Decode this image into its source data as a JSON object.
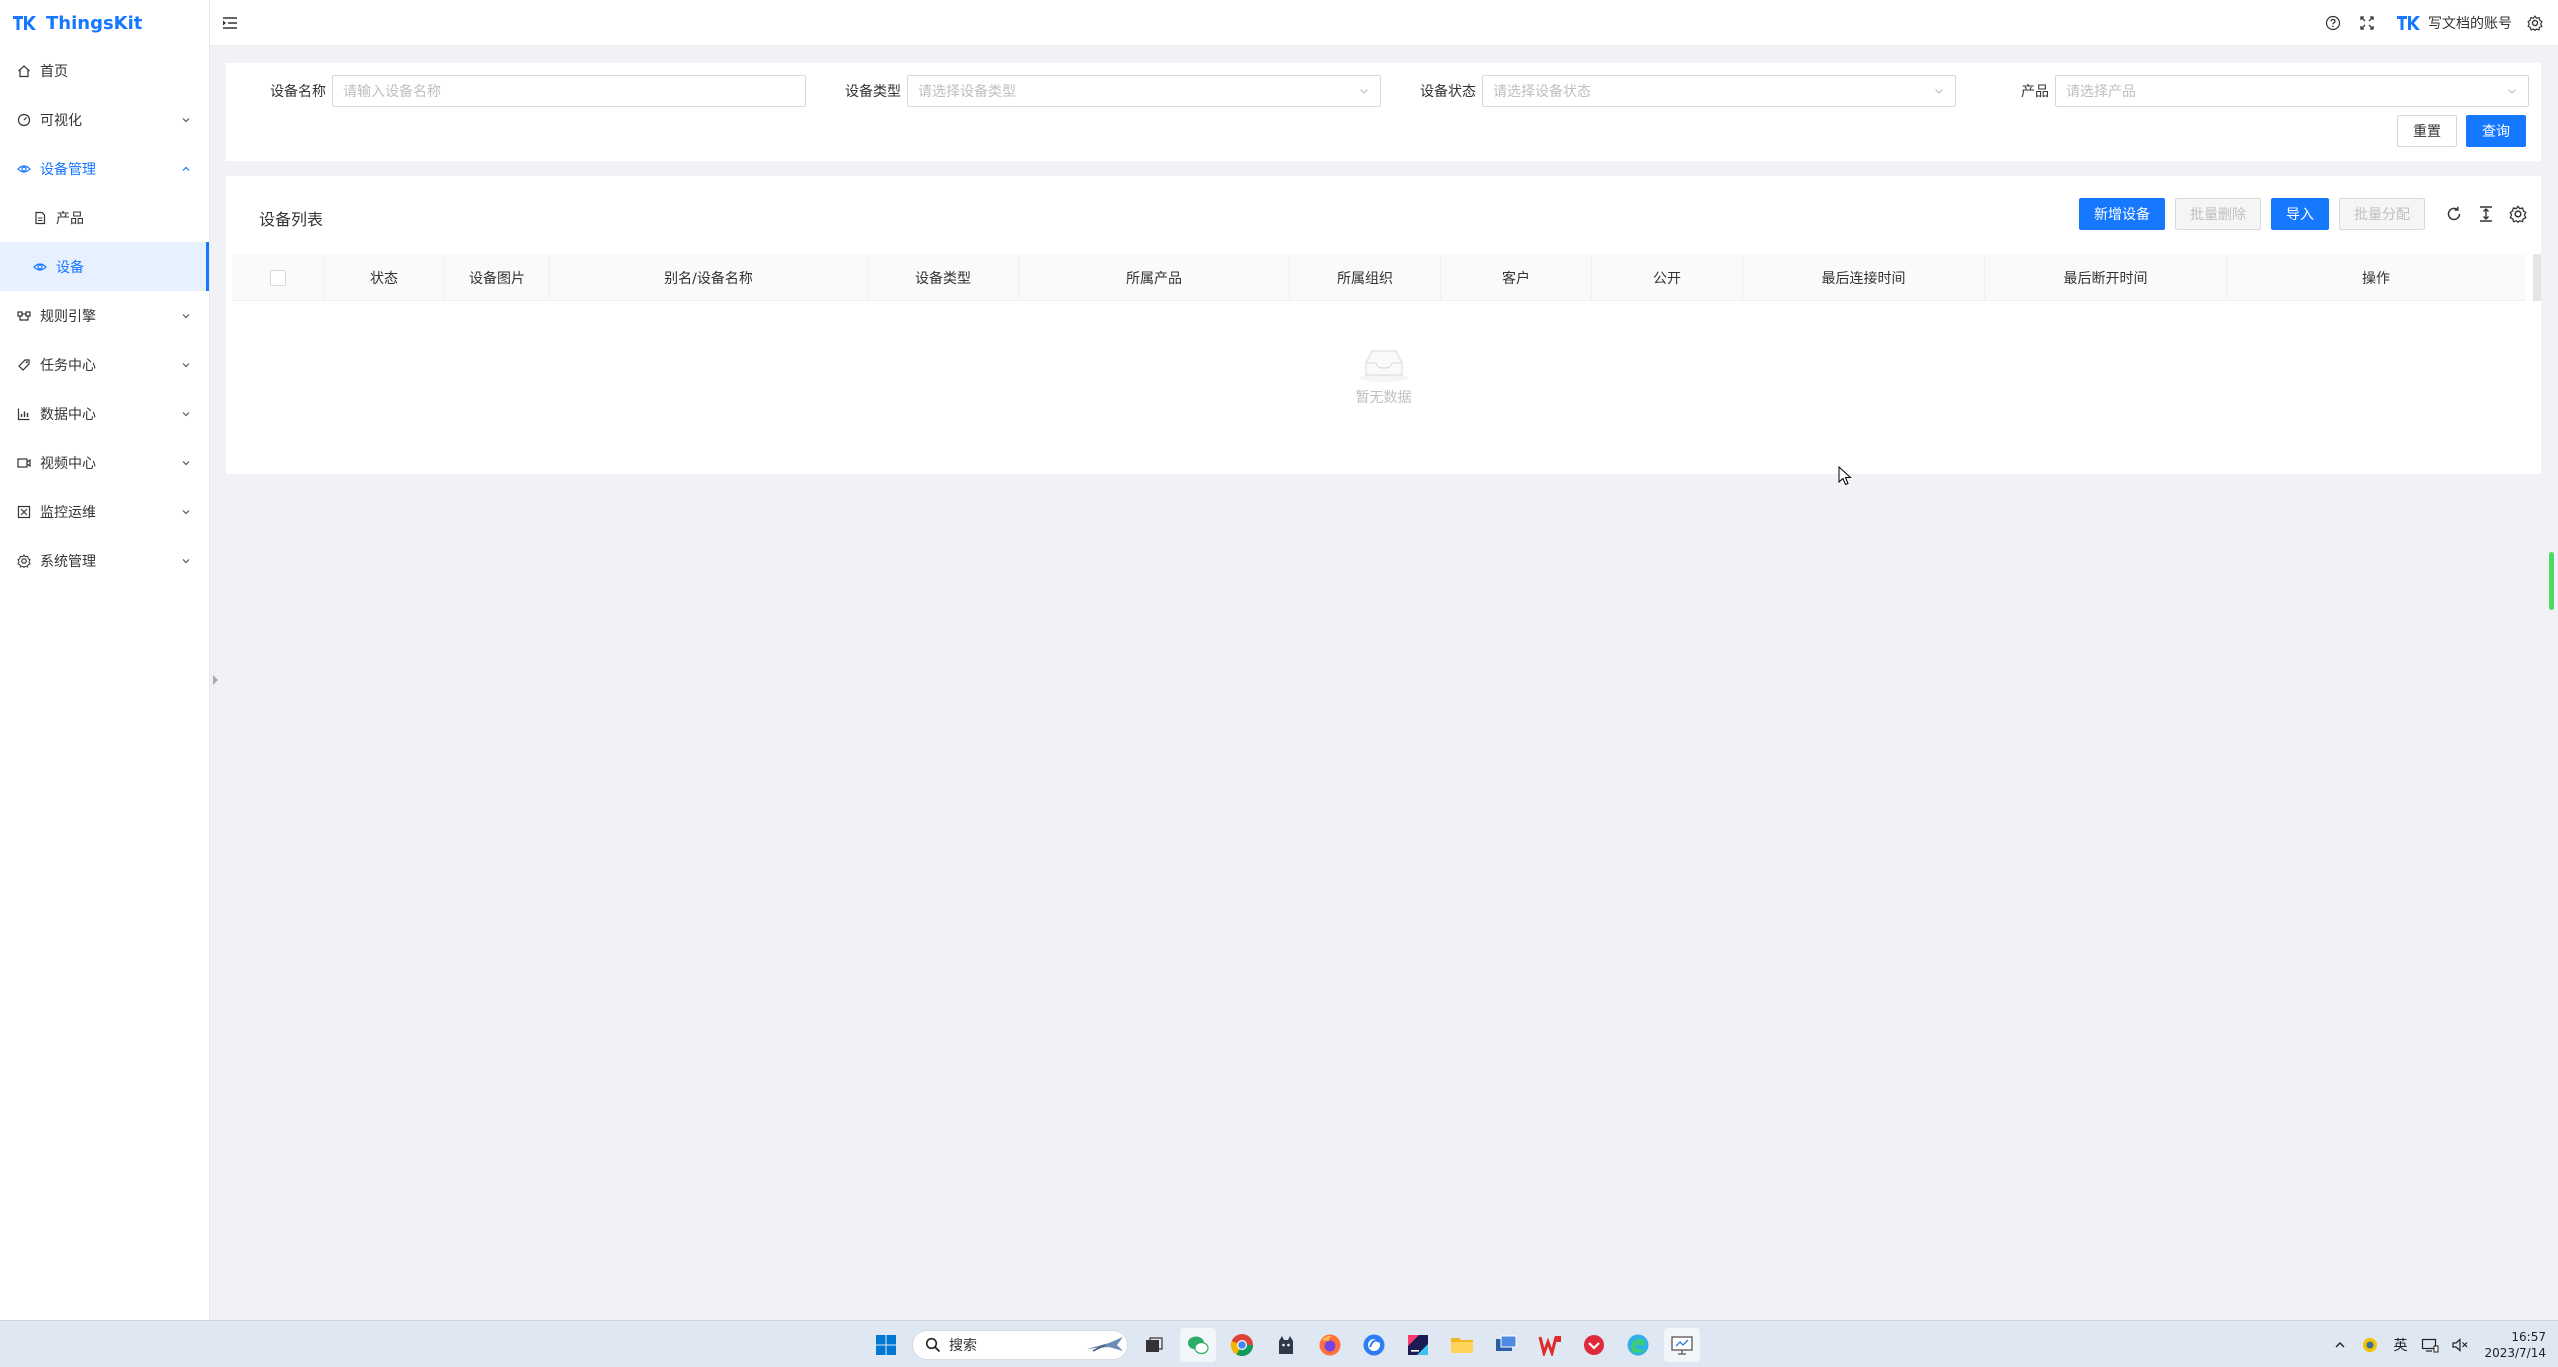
{
  "app": {
    "name": "ThingsKit"
  },
  "sidebar": {
    "items": [
      {
        "label": "首页",
        "icon": "home-icon"
      },
      {
        "label": "可视化",
        "icon": "dashboard-icon"
      },
      {
        "label": "设备管理",
        "icon": "device-management-icon"
      },
      {
        "label": "产品",
        "icon": "document-icon"
      },
      {
        "label": "设备",
        "icon": "device-eye-icon"
      },
      {
        "label": "规则引擎",
        "icon": "rule-engine-icon"
      },
      {
        "label": "任务中心",
        "icon": "task-icon"
      },
      {
        "label": "数据中心",
        "icon": "chart-icon"
      },
      {
        "label": "视频中心",
        "icon": "video-icon"
      },
      {
        "label": "监控运维",
        "icon": "monitor-icon"
      },
      {
        "label": "系统管理",
        "icon": "settings-icon"
      }
    ]
  },
  "header": {
    "user_name": "写文档的账号"
  },
  "search": {
    "device_name_label": "设备名称",
    "device_name_placeholder": "请输入设备名称",
    "device_type_label": "设备类型",
    "device_type_placeholder": "请选择设备类型",
    "device_status_label": "设备状态",
    "device_status_placeholder": "请选择设备状态",
    "product_label": "产品",
    "product_placeholder": "请选择产品",
    "reset_label": "重置",
    "query_label": "查询"
  },
  "table": {
    "title": "设备列表",
    "add_label": "新增设备",
    "batch_delete_label": "批量删除",
    "import_label": "导入",
    "batch_assign_label": "批量分配",
    "columns": [
      "状态",
      "设备图片",
      "别名/设备名称",
      "设备类型",
      "所属产品",
      "所属组织",
      "客户",
      "公开",
      "最后连接时间",
      "最后断开时间",
      "操作"
    ],
    "empty_text": "暂无数据"
  },
  "taskbar": {
    "search_label": "搜索",
    "ime_label": "英",
    "time": "16:57",
    "date": "2023/7/14"
  },
  "colors": {
    "primary": "#1677ff",
    "page_bg": "#f0f2f5"
  }
}
